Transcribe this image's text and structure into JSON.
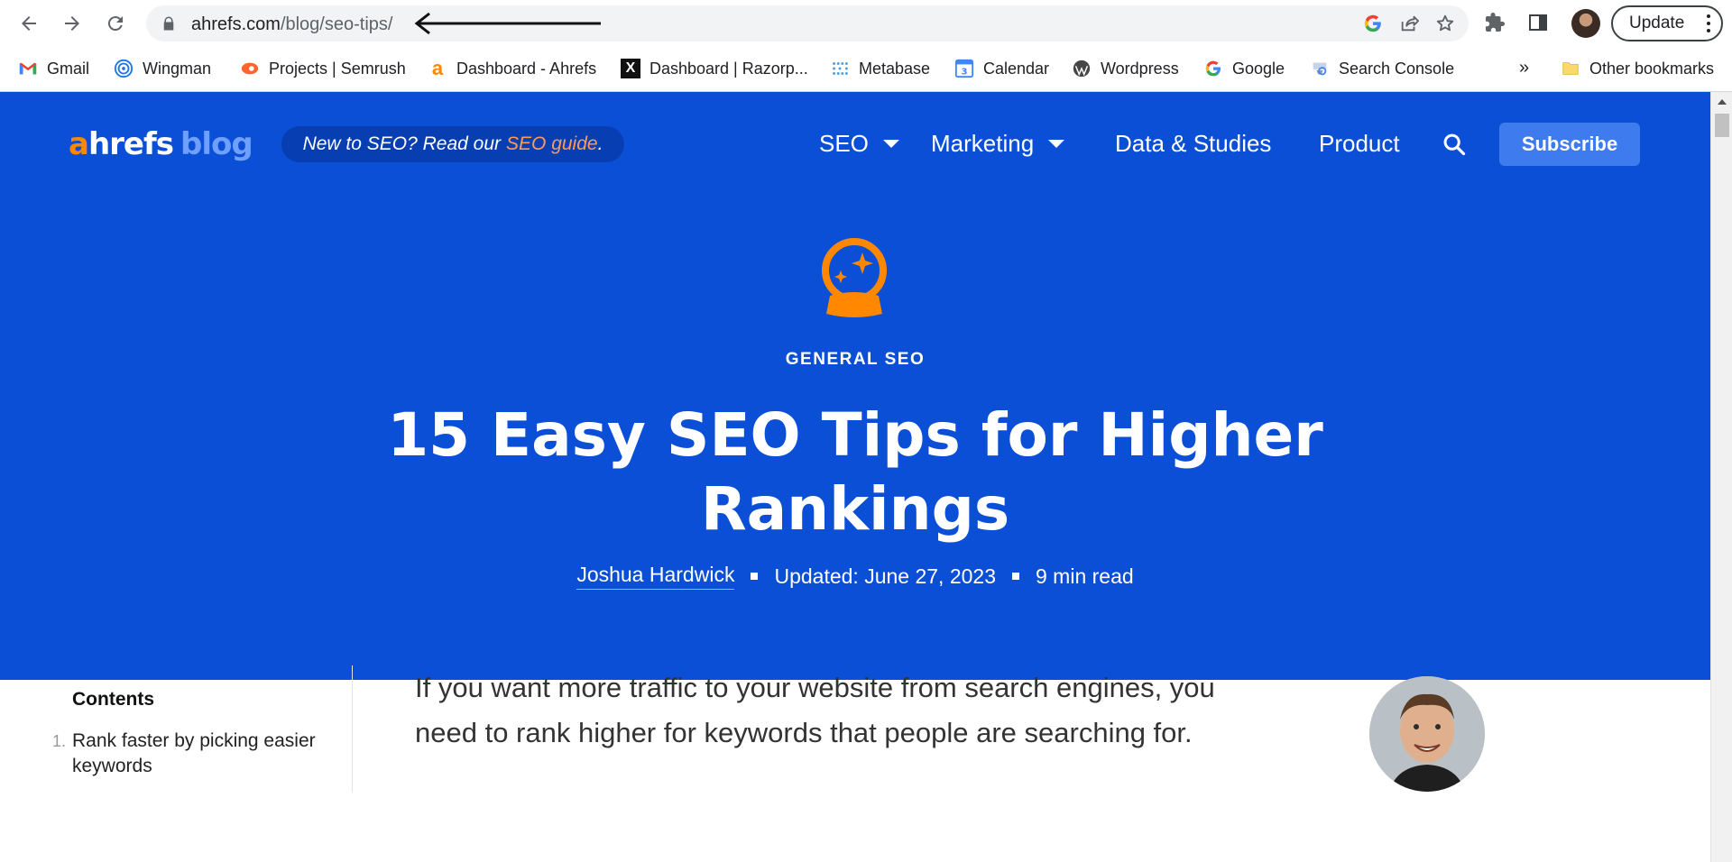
{
  "browser": {
    "url_host": "ahrefs.com",
    "url_path": "/blog/seo-tips/",
    "update_label": "Update"
  },
  "bookmarks": [
    {
      "label": "Gmail",
      "icon": "gmail-icon"
    },
    {
      "label": "Wingman",
      "icon": "wingman-icon"
    },
    {
      "label": "Projects | Semrush",
      "icon": "semrush-icon"
    },
    {
      "label": "Dashboard - Ahrefs",
      "icon": "ahrefs-icon"
    },
    {
      "label": "Dashboard | Razorp...",
      "icon": "razorpay-icon"
    },
    {
      "label": "Metabase",
      "icon": "metabase-icon"
    },
    {
      "label": "Calendar",
      "icon": "calendar-icon"
    },
    {
      "label": "Wordpress",
      "icon": "wordpress-icon"
    },
    {
      "label": "Google",
      "icon": "google-icon"
    },
    {
      "label": "Search Console",
      "icon": "search-console-icon"
    }
  ],
  "bookmarks_more": "»",
  "other_bookmarks": "Other bookmarks",
  "site": {
    "logo_a": "a",
    "logo_hrefs": "hrefs",
    "logo_blog": "blog",
    "promo_text": "New to SEO? Read our",
    "promo_link": "SEO guide",
    "promo_end": ".",
    "nav": {
      "seo": "SEO",
      "marketing": "Marketing",
      "data_studies": "Data & Studies",
      "product": "Product"
    },
    "subscribe_label": "Subscribe"
  },
  "article": {
    "category": "GENERAL SEO",
    "title_line1": "15 Easy SEO Tips for Higher",
    "title_line2": "Rankings",
    "author": "Joshua Hardwick",
    "updated": "Updated: June 27, 2023",
    "read_time": "9 min read",
    "intro_line1": "If you want more traffic to your website from search engines, you",
    "intro_line2": "need to rank higher for keywords that people are searching for."
  },
  "toc": {
    "title": "Contents",
    "items": [
      {
        "num": "1.",
        "label_line1": "Rank faster by picking easier",
        "label_line2": "keywords"
      }
    ]
  },
  "colors": {
    "hero_bg": "#0a4fd6",
    "accent_orange": "#ff8800",
    "subscribe_bg": "#3e7bef"
  }
}
